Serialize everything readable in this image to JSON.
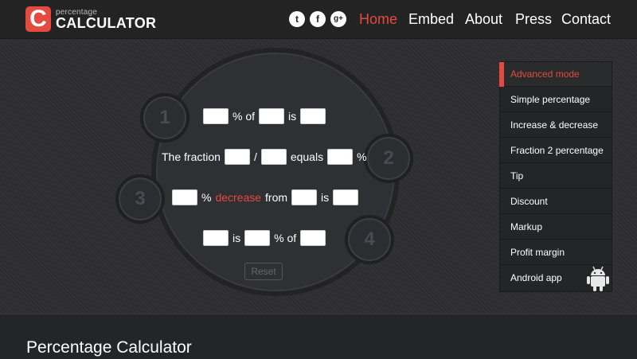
{
  "logo": {
    "mark": "C",
    "small": "percentage",
    "big": "CALCULATOR"
  },
  "social": [
    {
      "icon": "twitter-icon",
      "glyph": "t"
    },
    {
      "icon": "facebook-icon",
      "glyph": "f"
    },
    {
      "icon": "google-plus-icon",
      "glyph": "g+"
    }
  ],
  "nav": [
    {
      "label": "Home",
      "active": true
    },
    {
      "label": "Embed",
      "active": false
    },
    {
      "label": "About",
      "active": false
    },
    {
      "label": "Press",
      "active": false
    },
    {
      "label": "Contact",
      "active": false
    }
  ],
  "badges": [
    "1",
    "2",
    "3",
    "4"
  ],
  "calc": {
    "row1": {
      "t1": "% of",
      "t2": "is"
    },
    "row2": {
      "t1": "The fraction",
      "t2": "/",
      "t3": "equals",
      "t4": "%"
    },
    "row3": {
      "t1": "%",
      "t2": "decrease",
      "t3": "from",
      "t4": "is"
    },
    "row4": {
      "t1": "is",
      "t2": "% of"
    },
    "reset": "Reset"
  },
  "menu": [
    {
      "label": "Advanced mode",
      "active": true
    },
    {
      "label": "Simple percentage",
      "active": false
    },
    {
      "label": "Increase & decrease",
      "active": false
    },
    {
      "label": "Fraction 2 percentage",
      "active": false
    },
    {
      "label": "Tip",
      "active": false
    },
    {
      "label": "Discount",
      "active": false
    },
    {
      "label": "Markup",
      "active": false
    },
    {
      "label": "Profit margin",
      "active": false
    },
    {
      "label": "Android app",
      "active": false
    }
  ],
  "footer": {
    "title": "Percentage Calculator"
  },
  "colors": {
    "accent": "#e44a3d",
    "background": "#2e2e30",
    "header": "#232324"
  }
}
